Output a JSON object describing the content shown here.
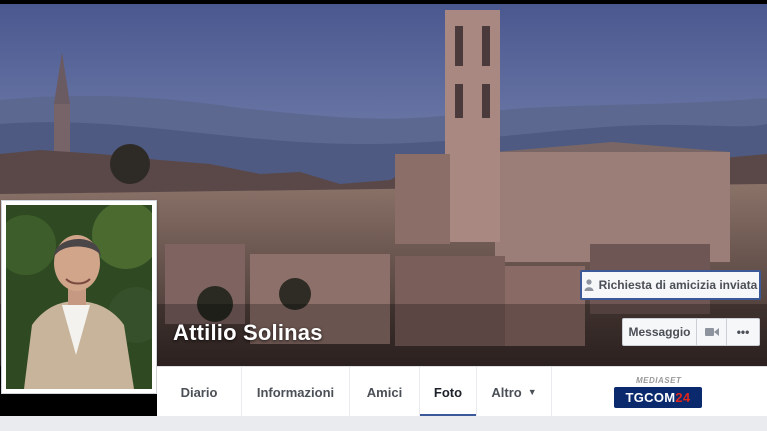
{
  "profile": {
    "name": "Attilio Solinas"
  },
  "actions": {
    "friend_request_label": "Richiesta di amicizia inviata",
    "message_label": "Messaggio",
    "more_label": "•••"
  },
  "tabs": [
    {
      "label": "Diario",
      "active": false
    },
    {
      "label": "Informazioni",
      "active": false
    },
    {
      "label": "Amici",
      "active": false
    },
    {
      "label": "Foto",
      "active": true
    },
    {
      "label": "Altro",
      "active": false
    }
  ],
  "broadcaster": {
    "small_label": "MEDIASET",
    "logo_text_a": "TGCOM",
    "logo_text_b": "24"
  },
  "colors": {
    "facebook_blue": "#3b5998",
    "sky": "#6a7aa6",
    "tab_text": "#4b4f56"
  }
}
